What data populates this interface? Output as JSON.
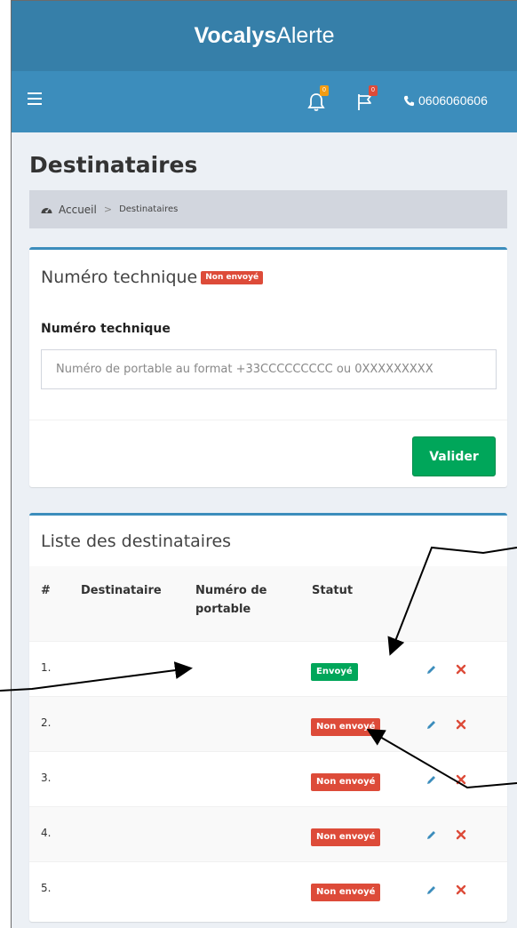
{
  "app": {
    "brand_bold": "Vocalys",
    "brand_rest": "Alerte"
  },
  "navbar": {
    "bell_badge": "0",
    "flag_badge": "0",
    "phone": "0606060606"
  },
  "page": {
    "title": "Destinataires"
  },
  "breadcrumb": {
    "home": "Accueil",
    "separator": ">",
    "current": "Destinataires"
  },
  "technical": {
    "title": "Numéro technique",
    "status": "Non envoyé",
    "field_label": "Numéro technique",
    "input_value": "",
    "input_placeholder": "Numéro de portable au format +33CCCCCCCCC ou 0XXXXXXXXX",
    "submit_label": "Valider"
  },
  "list": {
    "title": "Liste des destinataires",
    "columns": {
      "num": "#",
      "recipient": "Destinataire",
      "phone": "Numéro de portable",
      "status": "Statut"
    },
    "rows": [
      {
        "num": "1.",
        "recipient": "",
        "phone": "",
        "status": "Envoyé"
      },
      {
        "num": "2.",
        "recipient": "",
        "phone": "",
        "status": "Non envoyé"
      },
      {
        "num": "3.",
        "recipient": "",
        "phone": "",
        "status": "Non envoyé"
      },
      {
        "num": "4.",
        "recipient": "",
        "phone": "",
        "status": "Non envoyé"
      },
      {
        "num": "5.",
        "recipient": "",
        "phone": "",
        "status": "Non envoyé"
      }
    ]
  },
  "colors": {
    "brand_dark": "#367fa9",
    "brand": "#3c8dbc",
    "success": "#00a65a",
    "danger": "#dd4b39",
    "warning": "#f39c12"
  },
  "icons": [
    "menu-icon",
    "bell-icon",
    "flag-icon",
    "phone-icon",
    "dashboard-icon",
    "pencil-icon",
    "close-icon"
  ]
}
